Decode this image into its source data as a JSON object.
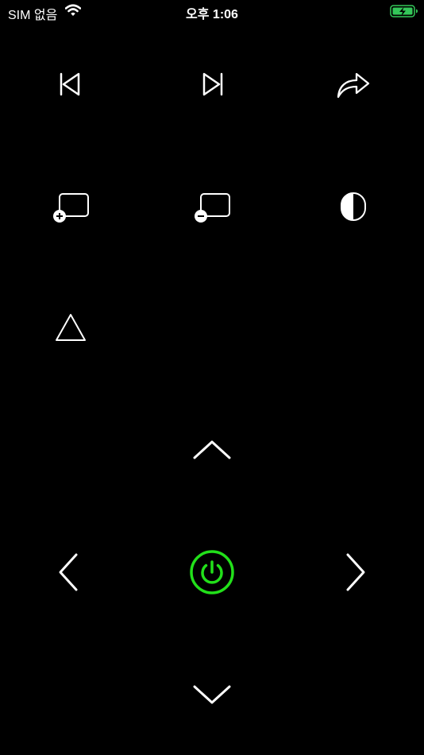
{
  "status_bar": {
    "carrier": "SIM 없음",
    "time": "오후 1:06",
    "wifi_icon": "wifi-icon",
    "battery_icon": "battery-charging-icon",
    "battery_color": "#34C759"
  },
  "colors": {
    "background": "#000000",
    "icon": "#FFFFFF",
    "power": "#22E01A"
  },
  "remote": {
    "row1": [
      {
        "icon": "previous-track-icon"
      },
      {
        "icon": "next-track-icon"
      },
      {
        "icon": "share-forward-icon"
      }
    ],
    "row2": [
      {
        "icon": "screen-add-icon"
      },
      {
        "icon": "screen-remove-icon"
      },
      {
        "icon": "contrast-icon"
      }
    ],
    "row3": [
      {
        "icon": "triangle-icon"
      }
    ],
    "dpad": {
      "up": "chevron-up-icon",
      "left": "chevron-left-icon",
      "center": "power-icon",
      "right": "chevron-right-icon",
      "down": "chevron-down-icon"
    }
  }
}
